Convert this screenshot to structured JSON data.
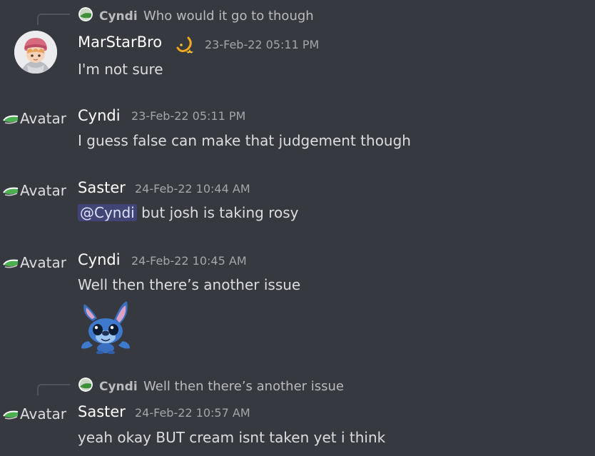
{
  "messages": [
    {
      "reply": {
        "name": "Cyndi",
        "text": "Who would it go to though"
      },
      "author": "MarStarBro",
      "timestamp": "23-Feb-22 05:11 PM",
      "text": "I'm not sure",
      "avatar": "profile-picture"
    },
    {
      "author": "Cyndi",
      "avatar_alt": "Avatar",
      "timestamp": "23-Feb-22 05:11 PM",
      "text": "I guess false can make that judgement though"
    },
    {
      "author": "Saster",
      "avatar_alt": "Avatar",
      "timestamp": "24-Feb-22 10:44 AM",
      "mention": "@Cyndi",
      "text": "but josh is taking rosy"
    },
    {
      "author": "Cyndi",
      "avatar_alt": "Avatar",
      "timestamp": "24-Feb-22 10:45 AM",
      "text": "Well then there’s another issue",
      "sticker": "stitch-sticker"
    },
    {
      "reply": {
        "name": "Cyndi",
        "text": "Well then there’s another issue"
      },
      "author": "Saster",
      "avatar_alt": "Avatar",
      "timestamp": "24-Feb-22 10:57 AM",
      "text": "yeah okay BUT cream isnt taken yet i think"
    }
  ],
  "colors": {
    "background": "#36393f",
    "username": "#ffffff",
    "message": "#dcddde",
    "timestamp": "#a3a6aa",
    "mention_bg": "#4a4f86"
  }
}
